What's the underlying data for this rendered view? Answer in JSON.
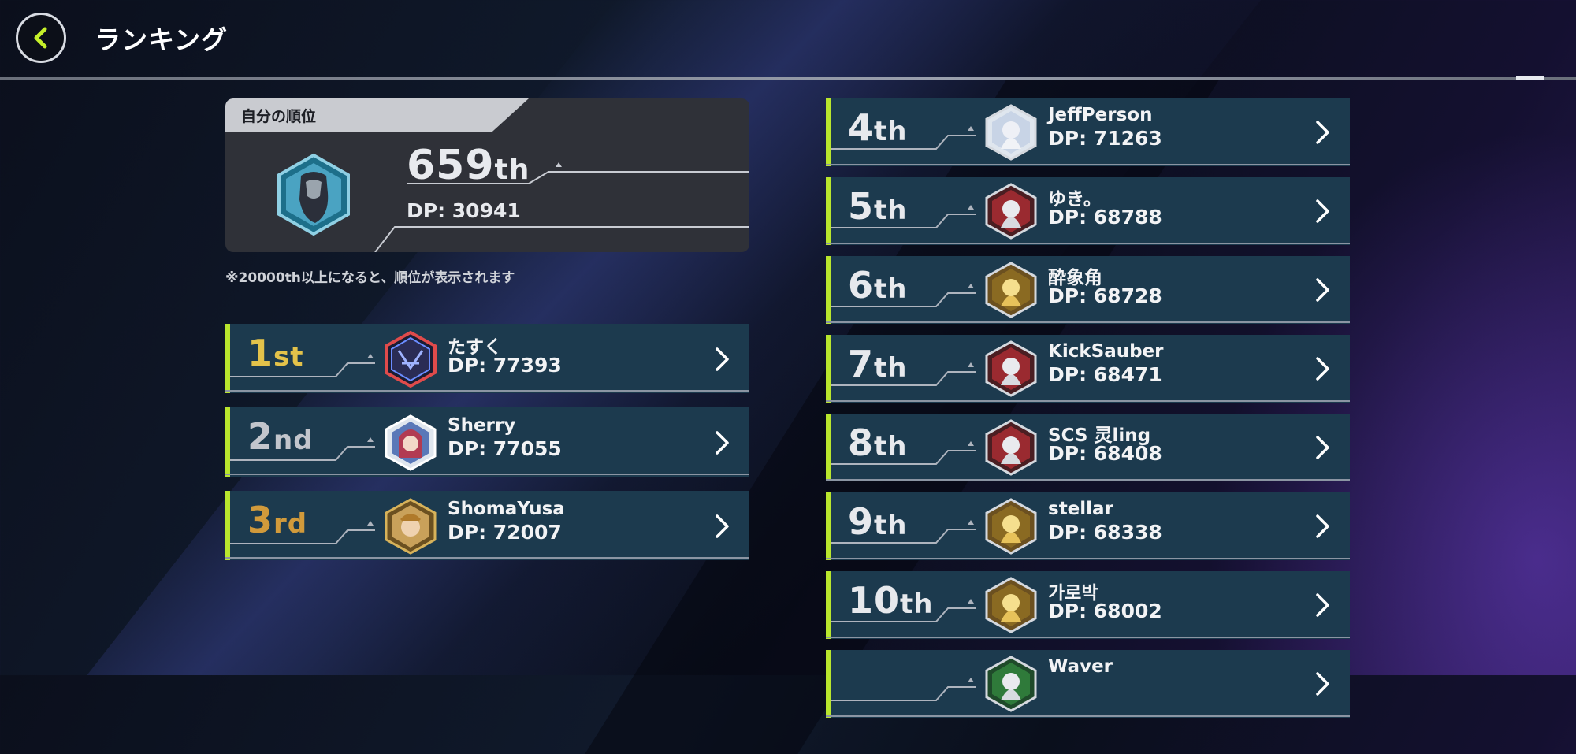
{
  "header": {
    "title": "ランキング"
  },
  "my_rank": {
    "tab_label": "自分の順位",
    "rank_number": "659",
    "rank_suffix": "th",
    "dp": "DP: 30941",
    "note": "※20000th以上になると、順位が表示されます"
  },
  "left_rankings": [
    {
      "rank": "1",
      "suffix": "st",
      "name": "たすく",
      "dp": "DP: 77393",
      "medal": "gold"
    },
    {
      "rank": "2",
      "suffix": "nd",
      "name": "Sherry",
      "dp": "DP: 77055",
      "medal": "silver"
    },
    {
      "rank": "3",
      "suffix": "rd",
      "name": "ShomaYusa",
      "dp": "DP: 72007",
      "medal": "bronze"
    }
  ],
  "right_rankings": [
    {
      "rank": "4",
      "suffix": "th",
      "name": "JeffPerson",
      "dp": "DP: 71263"
    },
    {
      "rank": "5",
      "suffix": "th",
      "name": "ゆき。",
      "dp": "DP: 68788"
    },
    {
      "rank": "6",
      "suffix": "th",
      "name": "酔象角",
      "dp": "DP: 68728"
    },
    {
      "rank": "7",
      "suffix": "th",
      "name": "KickSauber",
      "dp": "DP: 68471"
    },
    {
      "rank": "8",
      "suffix": "th",
      "name": "SCS 灵ling",
      "dp": "DP: 68408"
    },
    {
      "rank": "9",
      "suffix": "th",
      "name": "stellar",
      "dp": "DP: 68338"
    },
    {
      "rank": "10",
      "suffix": "th",
      "name": "가로박",
      "dp": "DP: 68002"
    },
    {
      "rank": "",
      "suffix": "",
      "name": "Waver",
      "dp": ""
    }
  ],
  "colors": {
    "accent": "#b9e62d",
    "row_bg": "#1c3a4e",
    "panel_bg": "#2f3138",
    "gold": "#e3c24a",
    "silver": "#c2c5cc",
    "bronze": "#d19a3b"
  },
  "icons": {
    "back": "chevron-left-icon",
    "row_open": "chevron-right-icon"
  }
}
